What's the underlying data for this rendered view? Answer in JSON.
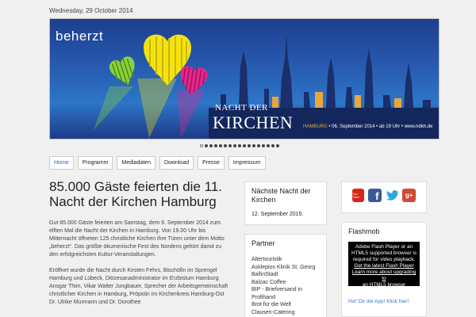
{
  "header": {
    "date": "Wednesday, 29 October 2014"
  },
  "banner": {
    "brand": "beherzt",
    "title_small": "NACHT DER",
    "title_large": "KIRCHEN",
    "info_city": "HAMBURG",
    "info_rest": "• 06. September 2014 • ab 19 Uhr • www.ndkh.de",
    "colors": {
      "bg_top": "#1d3f8f",
      "heart_green": "#8bd23a",
      "heart_yellow": "#f4e30f",
      "heart_pink": "#e6268c",
      "skyline": "#1a2f6b",
      "accent": "#e9a63c"
    }
  },
  "slider": {
    "dots": 17,
    "active_index": 0
  },
  "nav": {
    "items": [
      "Home",
      "Programm",
      "Mediadaten",
      "Download",
      "Presse",
      "Impressum"
    ],
    "active": "Home"
  },
  "article": {
    "title": "85.000 Gäste feierten die 11. Nacht der Kirchen Hamburg",
    "paragraphs": [
      "Gut 85.000 Gäste feierten am Samstag, dem 6. September 2014 zum elften Mal die Nacht der Kirchen in Hamburg. Von 19.00 Uhr bis Mitternacht öffneten 125 christliche Kirchen ihre Türen unter dem Motto „beherzt“. Das größte ökumenische Fest des Nordens gehört damit zu den erfolgreichsten Kultur-Veranstaltungen.",
      "Eröffnet wurde die Nacht durch Kirsten Fehrs, Bischöfin im Sprengel Hamburg und Lübeck, Diözesanadministrator im Erzbistum Hamburg Ansgar Thim, Vikar Walter Jungbauer, Sprecher der Arbeitsgemeinschaft christlicher Kirchen in Hamburg, Pröpstin im Kirchenkreis Hamburg-Ost Dr. Ulrike Murmann und Dr. Dorothee"
    ]
  },
  "next_event": {
    "title": "Nächste Nacht der Kirchen",
    "date": "12. September 2015."
  },
  "partners": {
    "title": "Partner",
    "items": [
      "Altertouristik",
      "Asklepios Klinik St. Georg",
      "BallinStadt",
      "Balzac Coffee",
      "BIP - Briefversand in Profihand",
      "Brot für die Welt",
      "Clausen-Catering"
    ]
  },
  "social": {
    "icons": [
      "youtube-icon",
      "facebook-icon",
      "twitter-icon",
      "google-plus-icon"
    ],
    "youtube_label": "You Tube",
    "gplus_label": "g+"
  },
  "flashmob": {
    "title": "Flashmob",
    "line1": "Adobe Flash Player or an",
    "line2": "HTML5 supported browser is",
    "line3": "required for video playback.",
    "line4": "Get the latest Flash Player",
    "line5": "Learn more about upgrading to",
    "line6": "an HTML5 browser",
    "hint": "Hol' Dir die App! Klick hier!"
  }
}
